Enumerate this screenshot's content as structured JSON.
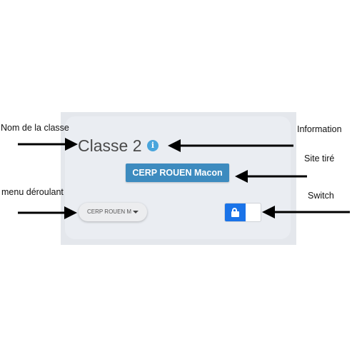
{
  "card": {
    "title": "Classe 2",
    "info_icon": "info-icon",
    "site_label": "CERP ROUEN Macon",
    "dropdown_value": "CERP ROUEN M",
    "switch_state": "locked",
    "switch_icon": "lock-icon",
    "switch_color": "#1a73e8",
    "badge_color": "#3d8bbf"
  },
  "annotations": {
    "nom_de_la_classe": "Nom de la classe",
    "information": "Information",
    "site_tire": "Site tiré",
    "menu_deroulant": "menu déroulant",
    "switch": "Switch"
  }
}
